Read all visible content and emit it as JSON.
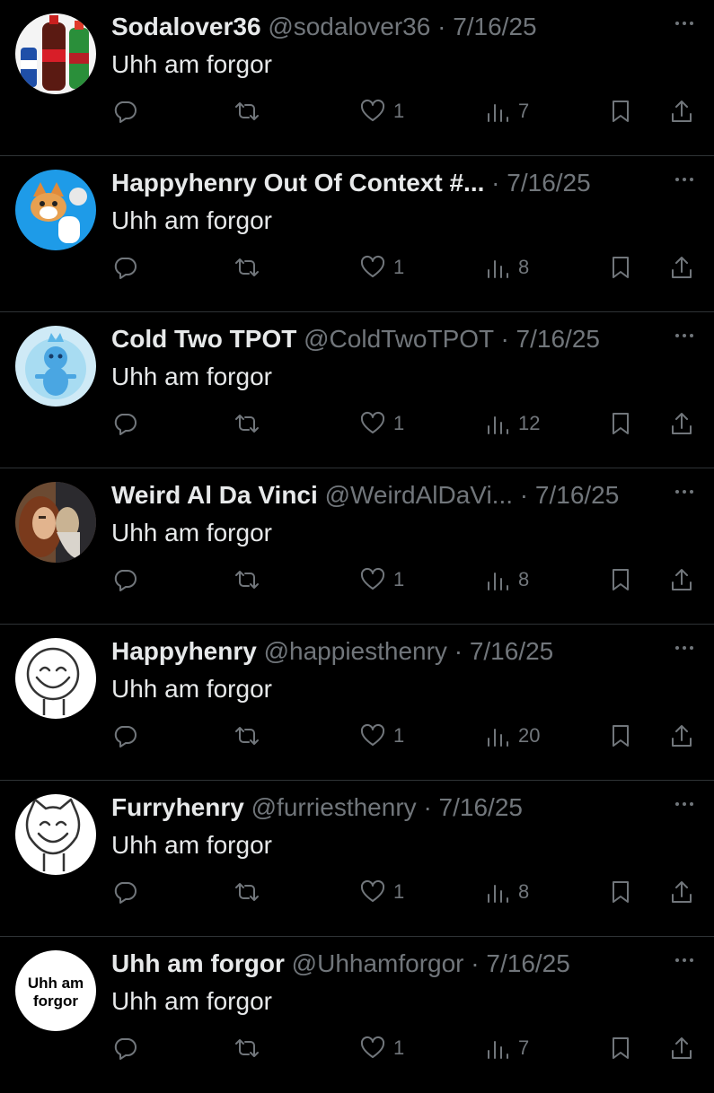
{
  "tweets": [
    {
      "name": "Sodalover36",
      "handle": "@sodalover36",
      "separator": "·",
      "date": "7/16/25",
      "text": "Uhh am forgor",
      "likes": "1",
      "views": "7",
      "avatar": "soda-bottles"
    },
    {
      "name": "Happyhenry Out Of Context #...",
      "handle": "",
      "separator": "·",
      "date": "7/16/25",
      "text": "Uhh am forgor",
      "likes": "1",
      "views": "8",
      "avatar": "cat-on-blue"
    },
    {
      "name": "Cold Two TPOT",
      "handle": "@ColdTwoTPOT",
      "separator": "·",
      "date": "7/16/25",
      "text": "Uhh am forgor",
      "likes": "1",
      "views": "12",
      "avatar": "blue-creature"
    },
    {
      "name": "Weird Al Da Vinci",
      "handle": "@WeirdAlDaVi...",
      "separator": "·",
      "date": "7/16/25",
      "text": "Uhh am forgor",
      "likes": "1",
      "views": "8",
      "avatar": "portrait"
    },
    {
      "name": "Happyhenry",
      "handle": "@happiesthenry",
      "separator": "·",
      "date": "7/16/25",
      "text": "Uhh am forgor",
      "likes": "1",
      "views": "20",
      "avatar": "smiley-doodle"
    },
    {
      "name": "Furryhenry",
      "handle": "@furriesthenry",
      "separator": "·",
      "date": "7/16/25",
      "text": "Uhh am forgor",
      "likes": "1",
      "views": "8",
      "avatar": "cat-doodle"
    },
    {
      "name": "Uhh am forgor",
      "handle": "@Uhhamforgor",
      "separator": "·",
      "date": "7/16/25",
      "text": "Uhh am forgor",
      "likes": "1",
      "views": "7",
      "avatar": "text-logo",
      "avatar_text": [
        "Uhh am",
        "forgor"
      ]
    }
  ],
  "colors": {
    "background": "#000000",
    "primary_text": "#e7e9ea",
    "secondary_text": "#71767b",
    "divider": "#2f3336"
  },
  "icons": [
    "reply-icon",
    "retweet-icon",
    "like-icon",
    "views-icon",
    "bookmark-icon",
    "share-icon",
    "more-icon"
  ]
}
